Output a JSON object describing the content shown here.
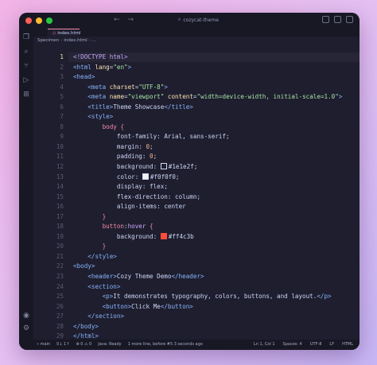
{
  "window": {
    "title": "cozycat-theme",
    "tab_label": "index.html",
    "breadcrumb": [
      "Specimen",
      "index.html",
      "..."
    ]
  },
  "code_lines": [
    {
      "n": "1",
      "active": true,
      "html": "<span class=\"kw\">&lt;!DOCTYPE html&gt;</span>"
    },
    {
      "n": "2",
      "html": "<span class=\"tag\">&lt;html</span> <span class=\"attr\">lang</span>=<span class=\"str\">\"en\"</span><span class=\"tag\">&gt;</span>"
    },
    {
      "n": "3",
      "html": "<span class=\"tag\">&lt;head&gt;</span>"
    },
    {
      "n": "4",
      "html": "    <span class=\"tag\">&lt;meta</span> <span class=\"attr\">charset</span>=<span class=\"str\">\"UTF-8\"</span><span class=\"tag\">&gt;</span>"
    },
    {
      "n": "5",
      "html": "    <span class=\"tag\">&lt;meta</span> <span class=\"attr\">name</span>=<span class=\"str\">\"viewport\"</span> <span class=\"attr\">content</span>=<span class=\"str\">\"width=device-width, initial-scale=1.0\"</span><span class=\"tag\">&gt;</span>"
    },
    {
      "n": "6",
      "html": "    <span class=\"tag\">&lt;title&gt;</span>Theme Showcase<span class=\"tag\">&lt;/title&gt;</span>"
    },
    {
      "n": "7",
      "html": "    <span class=\"tag\">&lt;style&gt;</span>"
    },
    {
      "n": "8",
      "html": "        <span class=\"sel\">body</span> <span class=\"brace\">{</span>"
    },
    {
      "n": "9",
      "html": "            <span class=\"prop\">font-family</span>: Arial, sans-serif;"
    },
    {
      "n": "10",
      "html": "            <span class=\"prop\">margin</span>: <span class=\"val\">0</span>;"
    },
    {
      "n": "11",
      "html": "            <span class=\"prop\">padding</span>: <span class=\"val\">0</span>;"
    },
    {
      "n": "12",
      "html": "            <span class=\"prop\">background</span>: <span class=\"sw\" style=\"background:#1e1e2f\"></span>#1e1e2f;"
    },
    {
      "n": "13",
      "html": "            <span class=\"prop\">color</span>: <span class=\"sw\" style=\"background:#f0f0f0\"></span>#f0f0f0;"
    },
    {
      "n": "14",
      "html": "            <span class=\"prop\">display</span>: flex;"
    },
    {
      "n": "15",
      "html": "            <span class=\"prop\">flex-direction</span>: column;"
    },
    {
      "n": "16",
      "html": "            <span class=\"prop\">align-items</span>: center"
    },
    {
      "n": "17",
      "html": "        <span class=\"brace\">}</span>"
    },
    {
      "n": "18",
      "html": "        <span class=\"sel\">button</span>:<span class=\"kw\">hover</span> <span class=\"brace\">{</span>"
    },
    {
      "n": "19",
      "html": "            <span class=\"prop\">background</span>: <span class=\"sw\" style=\"background:#ff4c3b;border-color:#ff4c3b\"></span>#ff4c3b"
    },
    {
      "n": "20",
      "html": "        <span class=\"brace\">}</span>"
    },
    {
      "n": "21",
      "html": "    <span class=\"tag\">&lt;/style&gt;</span>"
    },
    {
      "n": "22",
      "html": "<span class=\"tag\">&lt;body&gt;</span>"
    },
    {
      "n": "23",
      "html": "    <span class=\"tag\">&lt;header&gt;</span>Cozy Theme Demo<span class=\"tag\">&lt;/header&gt;</span>"
    },
    {
      "n": "24",
      "html": "    <span class=\"tag\">&lt;section&gt;</span>"
    },
    {
      "n": "25",
      "html": "        <span class=\"tag\">&lt;p&gt;</span>It demonstrates typography, colors, buttons, and layout.<span class=\"tag\">&lt;/p&gt;</span>"
    },
    {
      "n": "26",
      "html": "        <span class=\"tag\">&lt;button&gt;</span>Click Me<span class=\"tag\">&lt;/button&gt;</span>"
    },
    {
      "n": "27",
      "html": "    <span class=\"tag\">&lt;/section&gt;</span>"
    },
    {
      "n": "28",
      "html": "<span class=\"tag\">&lt;/body&gt;</span>"
    },
    {
      "n": "29",
      "html": "<span class=\"tag\">&lt;/html&gt;</span>"
    }
  ],
  "status": {
    "branch": "main",
    "sync": "0↓ 1↑",
    "problems": "⊗ 0  ⚠ 0",
    "java": "Java: Ready",
    "message": "1 more line, before #5   3 seconds ago",
    "position": "Ln 1, Col 1",
    "spaces": "Spaces: 4",
    "encoding": "UTF-8",
    "eol": "LF",
    "language": "HTML"
  },
  "colors": {
    "editor_bg": "#1e1e2f",
    "chrome_bg": "#181825",
    "accent": "#f38ba8"
  },
  "icons": [
    "files-icon",
    "search-icon",
    "source-control-icon",
    "debug-icon",
    "extensions-icon",
    "account-icon",
    "settings-icon"
  ]
}
